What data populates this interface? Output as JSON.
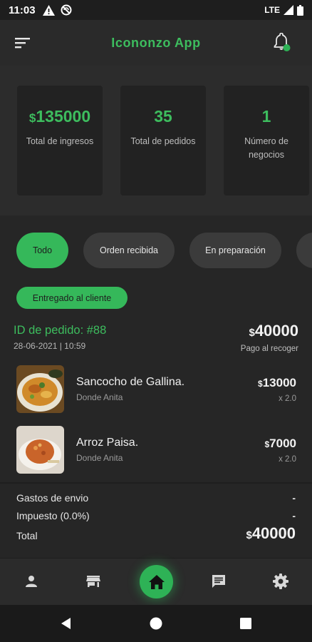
{
  "status_bar": {
    "time": "11:03",
    "network": "LTE",
    "icons": [
      "warning-icon",
      "no-signal-icon",
      "signal-icon",
      "battery-icon"
    ]
  },
  "app_bar": {
    "title": "Icononzo App",
    "menu_icon": "sort-menu-icon",
    "notification_icon": "bell-icon",
    "accent_color": "#3dbd5e"
  },
  "stats": [
    {
      "currency": "$",
      "value": "135000",
      "label": "Total de ingresos"
    },
    {
      "currency": "",
      "value": "35",
      "label": "Total de pedidos"
    },
    {
      "currency": "",
      "value": "1",
      "label": "Número de negocios"
    }
  ],
  "filters": {
    "chips": [
      "Todo",
      "Orden recibida",
      "En preparación"
    ],
    "selected": "Todo",
    "second_row": "Entregado al cliente"
  },
  "order": {
    "id_label": "ID de pedido: #88",
    "date": "28-06-2021 | 10:59",
    "currency": "$",
    "total": "40000",
    "payment": "Pago al recoger",
    "items": [
      {
        "name": "Sancocho de Gallina.",
        "shop": "Donde Anita",
        "currency": "$",
        "price": "13000",
        "qty": "x 2.0"
      },
      {
        "name": "Arroz Paisa.",
        "shop": "Donde Anita",
        "currency": "$",
        "price": "7000",
        "qty": "x 2.0"
      }
    ],
    "summary": {
      "shipping_label": "Gastos de envio",
      "shipping_value": "-",
      "tax_label": "Impuesto (0.0%)",
      "tax_value": "-",
      "total_label": "Total",
      "total_currency": "$",
      "total_value": "40000"
    }
  },
  "bottom_nav": [
    "person-icon",
    "store-icon",
    "home-icon",
    "chat-icon",
    "settings-icon"
  ],
  "system_nav": [
    "back-icon",
    "home-circle-icon",
    "recents-icon"
  ]
}
